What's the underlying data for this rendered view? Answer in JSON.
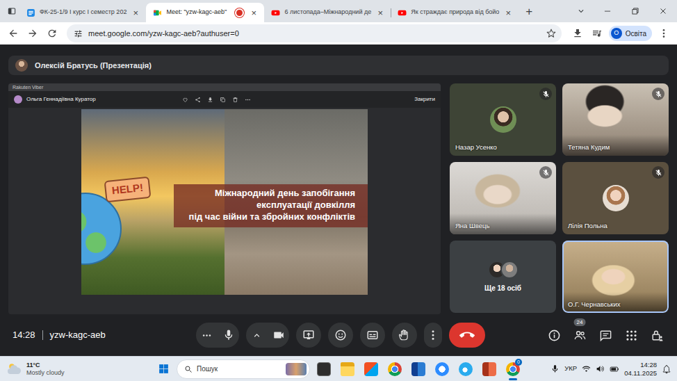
{
  "browser": {
    "tabs": [
      {
        "label": "ФК-25-1/9 І курс І семестр 202",
        "kind": "classroom",
        "selected": false,
        "recording": false,
        "close": "×"
      },
      {
        "label": "Meet: \"yzw-kagc-aeb\"",
        "kind": "meet",
        "selected": true,
        "recording": true,
        "close": "×"
      },
      {
        "label": "6 листопада–Міжнародний де",
        "kind": "youtube",
        "selected": false,
        "recording": false,
        "close": "×"
      },
      {
        "label": "Як страждає природа від бойо",
        "kind": "youtube",
        "selected": false,
        "recording": false,
        "close": "×"
      }
    ],
    "new_tab": "+",
    "address": "meet.google.com/yzw-kagc-aeb?authuser=0",
    "bookmarked": false,
    "profile": {
      "initial": "О",
      "label": "Освіта"
    }
  },
  "meet": {
    "presenter": "Олексій Братусь (Презентація)",
    "shared_window": {
      "app": "Rakuten Viber",
      "sender": "Ольга Геннадіївна Куратор",
      "close": "Закрити",
      "slide": {
        "badge": "HELP!",
        "title_lines": [
          "Міжнародний день запобігання",
          "експлуатації довкілля",
          "під час війни та збройних конфліктів"
        ]
      }
    },
    "tiles": [
      {
        "name": "Назар Усенко",
        "kind": "avatar",
        "muted": true,
        "highlighted": false
      },
      {
        "name": "Тетяна Кудим",
        "kind": "video",
        "muted": true,
        "highlighted": false
      },
      {
        "name": "Яна Швець",
        "kind": "video",
        "muted": true,
        "highlighted": false
      },
      {
        "name": "Лілія Польна",
        "kind": "avatar",
        "muted": true,
        "highlighted": false
      },
      {
        "name": "Ще 18 осіб",
        "kind": "more",
        "muted": false,
        "highlighted": false
      },
      {
        "name": "О.Г. Чернавських",
        "kind": "video",
        "muted": false,
        "highlighted": true
      }
    ],
    "clock": "14:28",
    "code": "yzw-kagc-aeb",
    "mic_on": true,
    "camera_on": true,
    "people_count": "24"
  },
  "taskbar": {
    "weather": {
      "temp": "11°C",
      "condition": "Mostly cloudy"
    },
    "search": "Пошук",
    "apps": [
      {
        "kind": "terminal",
        "active": false
      },
      {
        "kind": "explorer",
        "active": false
      },
      {
        "kind": "store",
        "active": false
      },
      {
        "kind": "chrome",
        "active": false
      },
      {
        "kind": "word",
        "active": false
      },
      {
        "kind": "zoom",
        "active": false
      },
      {
        "kind": "telegram",
        "active": false
      },
      {
        "kind": "powerpoint",
        "active": false
      },
      {
        "kind": "chrome",
        "active": true,
        "badge": "0"
      }
    ],
    "language": "УКР",
    "time": "14:28",
    "date": "04.11.2025"
  }
}
